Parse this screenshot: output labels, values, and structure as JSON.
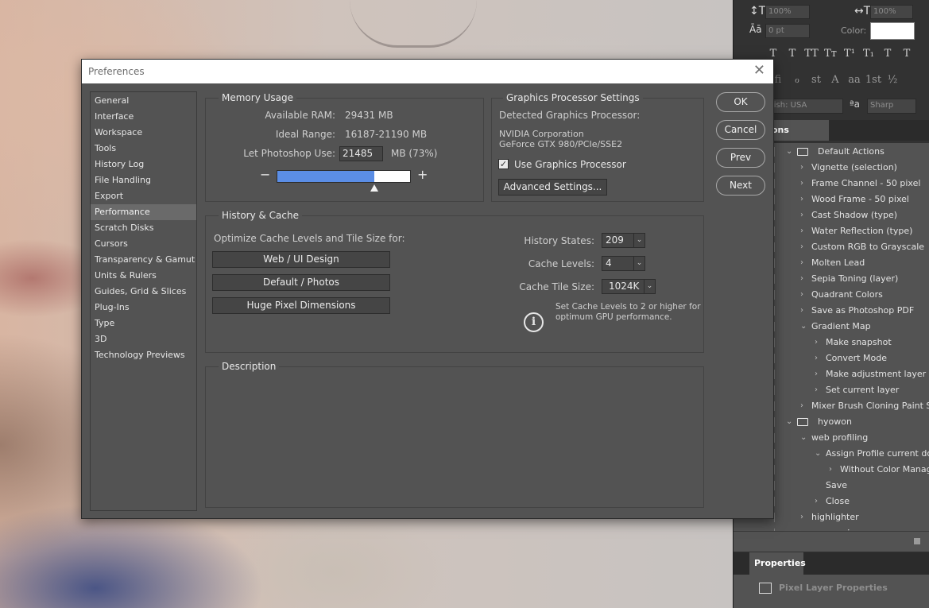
{
  "dialog": {
    "title": "Preferences",
    "nav_items": [
      {
        "label": "General"
      },
      {
        "label": "Interface"
      },
      {
        "label": "Workspace"
      },
      {
        "label": "Tools"
      },
      {
        "label": "History Log"
      },
      {
        "label": "File Handling"
      },
      {
        "label": "Export"
      },
      {
        "label": "Performance",
        "active": true
      },
      {
        "label": "Scratch Disks"
      },
      {
        "label": "Cursors"
      },
      {
        "label": "Transparency & Gamut"
      },
      {
        "label": "Units & Rulers"
      },
      {
        "label": "Guides, Grid & Slices"
      },
      {
        "label": "Plug-Ins"
      },
      {
        "label": "Type"
      },
      {
        "label": "3D"
      },
      {
        "label": "Technology Previews"
      }
    ],
    "memory": {
      "title": "Memory Usage",
      "available_label": "Available RAM:",
      "available_value": "29431 MB",
      "ideal_label": "Ideal Range:",
      "ideal_value": "16187-21190 MB",
      "use_label": "Let Photoshop Use:",
      "use_value": "21485",
      "use_suffix": "MB (73%)",
      "minus": "−",
      "plus": "+",
      "slider_fraction": 0.73
    },
    "gpu": {
      "title": "Graphics Processor Settings",
      "detected_label": "Detected Graphics Processor:",
      "vendor": "NVIDIA Corporation",
      "model": "GeForce GTX 980/PCIe/SSE2",
      "use_gpu_label": "Use Graphics Processor",
      "use_gpu_checked": "✓",
      "advanced_button": "Advanced Settings..."
    },
    "history_cache": {
      "title": "History & Cache",
      "optimize_label": "Optimize Cache Levels and Tile Size for:",
      "preset_buttons": [
        "Web / UI Design",
        "Default / Photos",
        "Huge Pixel Dimensions"
      ],
      "history_states_label": "History States:",
      "history_states_value": "209",
      "cache_levels_label": "Cache Levels:",
      "cache_levels_value": "4",
      "tile_size_label": "Cache Tile Size:",
      "tile_size_value": "1024K",
      "info_glyph": "i",
      "info_text": "Set Cache Levels to 2 or higher for optimum GPU performance."
    },
    "description": {
      "title": "Description"
    },
    "buttons": {
      "ok": "OK",
      "cancel": "Cancel",
      "prev": "Prev",
      "next": "Next"
    },
    "close_glyph": "✕",
    "dropdown_arrow": "⌄"
  },
  "ps_panel": {
    "leading_value": "100%",
    "vscale_value": "100%",
    "tracking_value": "0 pt",
    "color_label": "Color:",
    "typo_glyphs": [
      "T",
      "T",
      "TT",
      "Tт",
      "T¹",
      "T₁",
      "T",
      "T"
    ],
    "typo_glyphs2": [
      "fi",
      "ℴ",
      "st",
      "A",
      "aa",
      "1st",
      "½"
    ],
    "language": "lish: USA",
    "aa_label": "ªa",
    "antialias": "Sharp",
    "actions_tab": "ons",
    "actions": [
      {
        "label": "Default Actions",
        "level": 0,
        "folder": true,
        "open": true
      },
      {
        "label": "Vignette (selection)",
        "level": 1
      },
      {
        "label": "Frame Channel - 50 pixel",
        "level": 1
      },
      {
        "label": "Wood Frame - 50 pixel",
        "level": 1
      },
      {
        "label": "Cast Shadow (type)",
        "level": 1
      },
      {
        "label": "Water Reflection (type)",
        "level": 1
      },
      {
        "label": "Custom RGB to Grayscale",
        "level": 1
      },
      {
        "label": "Molten Lead",
        "level": 1
      },
      {
        "label": "Sepia Toning (layer)",
        "level": 1
      },
      {
        "label": "Quadrant Colors",
        "level": 1
      },
      {
        "label": "Save as Photoshop PDF",
        "level": 1
      },
      {
        "label": "Gradient Map",
        "level": 1,
        "open": true
      },
      {
        "label": "Make snapshot",
        "level": 2
      },
      {
        "label": "Convert Mode",
        "level": 2
      },
      {
        "label": "Make adjustment layer",
        "level": 2
      },
      {
        "label": "Set current layer",
        "level": 2
      },
      {
        "label": "Mixer Brush Cloning Paint Set",
        "level": 1
      },
      {
        "label": "hyowon",
        "level": 0,
        "folder": true,
        "open": true
      },
      {
        "label": "web profiling",
        "level": 1,
        "open": true
      },
      {
        "label": "Assign Profile current doc",
        "level": 2,
        "open": true
      },
      {
        "label": "Without Color Manageme",
        "level": 3
      },
      {
        "label": "Save",
        "level": 2,
        "nochev": true
      },
      {
        "label": "Close",
        "level": 2
      },
      {
        "label": "highlighter",
        "level": 1
      },
      {
        "label": "save as jpeg",
        "level": 1
      }
    ],
    "properties_tab": "Properties",
    "properties_body": "Pixel Layer Properties"
  }
}
